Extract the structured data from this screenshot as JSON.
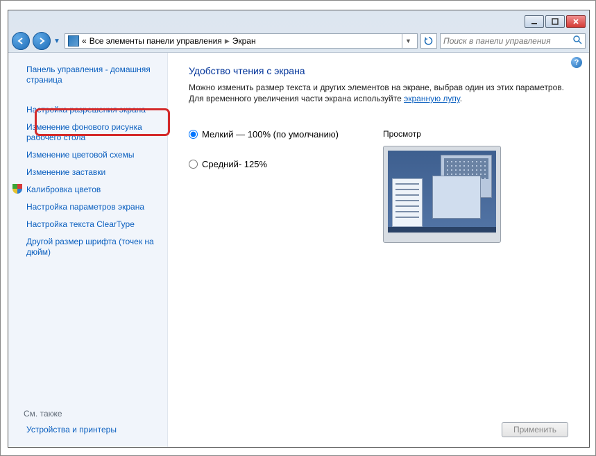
{
  "breadcrumb": {
    "prefix": "«",
    "part1": "Все элементы панели управления",
    "part2": "Экран"
  },
  "search": {
    "placeholder": "Поиск в панели управления"
  },
  "sidebar": {
    "home": "Панель управления - домашняя страница",
    "items": [
      "Настройка разрешения экрана",
      "Изменение фонового рисунка рабочего стола",
      "Изменение цветовой схемы",
      "Изменение заставки",
      "Калибровка цветов",
      "Настройка параметров экрана",
      "Настройка текста ClearType",
      "Другой размер шрифта (точек на дюйм)"
    ],
    "see_also_title": "См. также",
    "see_also_link": "Устройства и принтеры"
  },
  "main": {
    "title": "Удобство чтения с экрана",
    "desc1": "Можно изменить размер текста и других элементов на экране, выбрав один из этих параметров. Для временного увеличения части экрана используйте ",
    "desc_link": "экранную лупу",
    "desc2": ".",
    "radio_small": "Мелкий — 100% (по умолчанию)",
    "radio_medium": "Средний- 125%",
    "preview_label": "Просмотр",
    "apply_label": "Применить"
  }
}
